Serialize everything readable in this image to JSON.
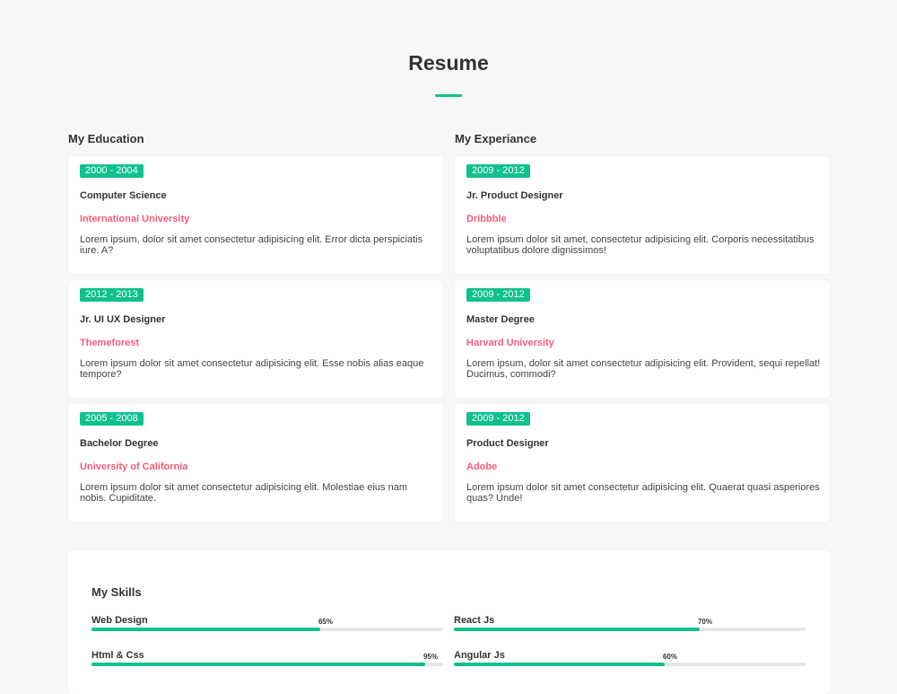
{
  "page": {
    "title": "Resume",
    "accent_color": "#10c18d",
    "org_color": "#f35d7c"
  },
  "education": {
    "heading": "My Education",
    "items": [
      {
        "period": "2000 - 2004",
        "role": "Computer Science",
        "org": "International University",
        "desc": "Lorem ipsum, dolor sit amet consectetur adipisicing elit. Error dicta perspiciatis iure. A?"
      },
      {
        "period": "2012 - 2013",
        "role": "Jr. UI UX Designer",
        "org": "Themeforest",
        "desc": "Lorem ipsum dolor sit amet consectetur adipisicing elit. Esse nobis alias eaque tempore?"
      },
      {
        "period": "2005 - 2008",
        "role": "Bachelor Degree",
        "org": "University of California",
        "desc": "Lorem ipsum dolor sit amet consectetur adipisicing elit. Molestiae eius nam nobis. Cupiditate."
      }
    ]
  },
  "experience": {
    "heading": "My Experiance",
    "items": [
      {
        "period": "2009 - 2012",
        "role": "Jr. Product Designer",
        "org": "Dribbble",
        "desc": "Lorem ipsum dolor sit amet, consectetur adipisicing elit. Corporis necessitatibus voluptatibus dolore dignissimos!"
      },
      {
        "period": "2009 - 2012",
        "role": "Master Degree",
        "org": "Harvard University",
        "desc": "Lorem ipsum, dolor sit amet consectetur adipisicing elit. Provident, sequi repellat! Ducimus, commodi?"
      },
      {
        "period": "2009 - 2012",
        "role": "Product Designer",
        "org": "Adobe",
        "desc": "Lorem ipsum dolor sit amet consectetur adipisicing elit. Quaerat quasi asperiores quas? Unde!"
      }
    ]
  },
  "skills": {
    "heading": "My Skills",
    "items": [
      {
        "name": "Web Design",
        "percent_label": "65%",
        "level": 0.65
      },
      {
        "name": "React Js",
        "percent_label": "70%",
        "level": 0.7
      },
      {
        "name": "Html & Css",
        "percent_label": "95%",
        "level": 0.95
      },
      {
        "name": "Angular Js",
        "percent_label": "60%",
        "level": 0.6
      }
    ]
  }
}
